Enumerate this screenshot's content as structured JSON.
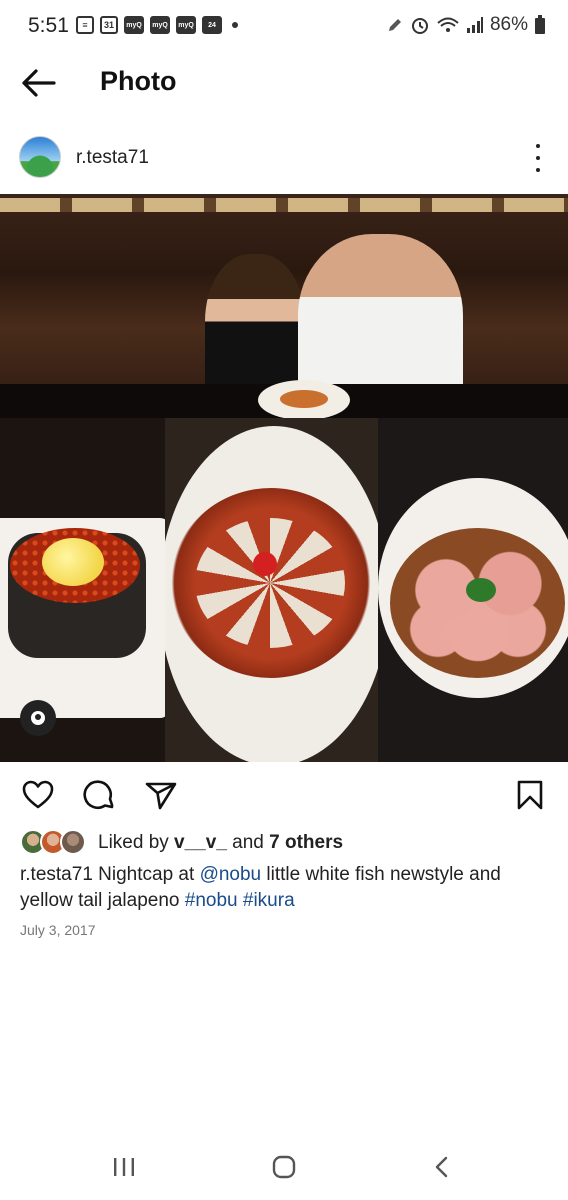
{
  "status_bar": {
    "time": "5:51",
    "notification_icons": [
      "news-icon",
      "calendar-31-icon",
      "myq-icon",
      "myq-icon",
      "myq-icon",
      "calendar-24-icon"
    ],
    "calendar_day_1": "31",
    "calendar_day_2": "24",
    "myq_label": "myQ",
    "battery_percent": "86%"
  },
  "app_bar": {
    "title": "Photo"
  },
  "post": {
    "username": "r.testa71",
    "likes": {
      "prefix": "Liked by ",
      "liker": "v__v_",
      "connector": " and ",
      "others": "7 others"
    },
    "caption": {
      "user": "r.testa71",
      "text_1": " Nightcap at ",
      "mention": "@nobu",
      "text_2": " little white fish newstyle and yellow tail jalapeno ",
      "hashtag_1": "#nobu",
      "space": " ",
      "hashtag_2": "#ikura"
    },
    "date": "July 3, 2017"
  },
  "colors": {
    "link": "#1a4c8c",
    "text": "#222222",
    "muted": "#777777"
  }
}
